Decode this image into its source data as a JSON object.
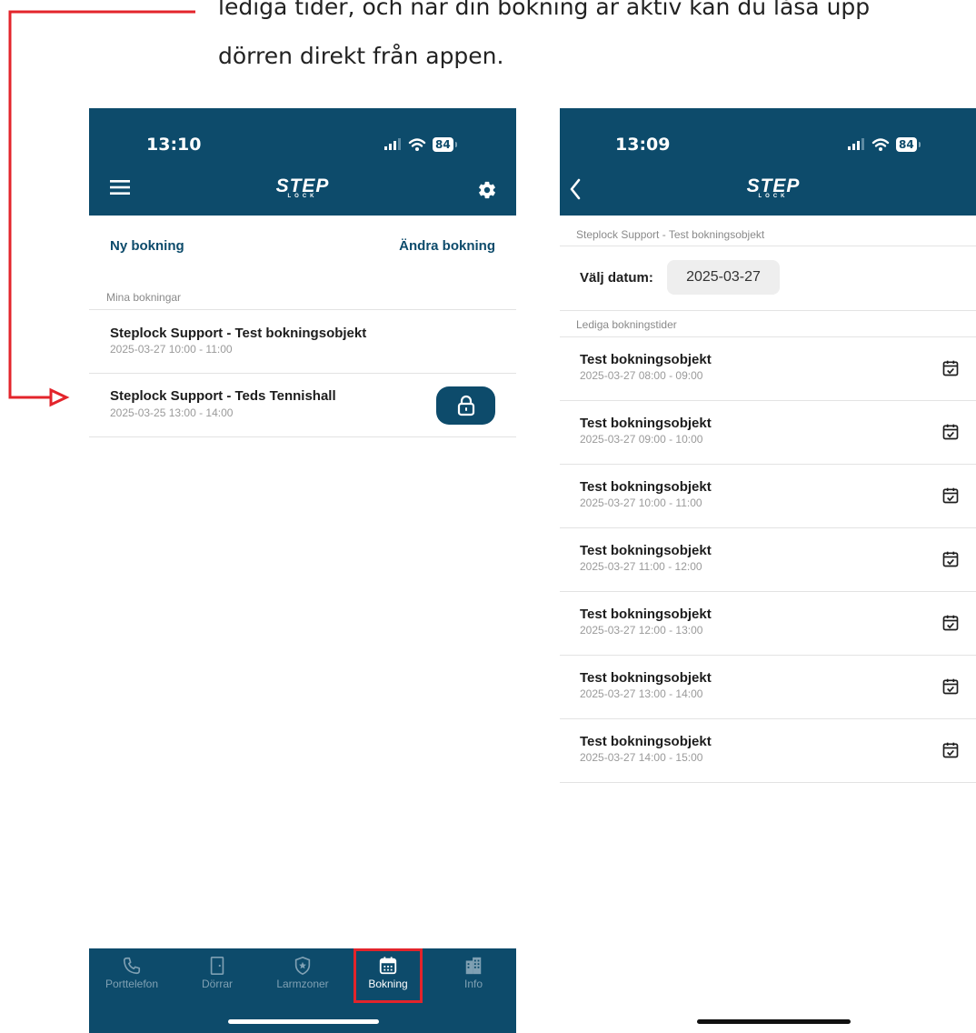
{
  "intro": {
    "line1": "lediga tider, och när din bokning är aktiv kan du låsa upp",
    "line2": "dörren direkt från appen."
  },
  "colors": {
    "brand": "#0d4b6b",
    "callout_red": "#e3242b"
  },
  "left_phone": {
    "status_time": "13:10",
    "battery": "84",
    "logo": "STEP",
    "logo_sub": "LOCK",
    "menu_icon": "hamburger-icon",
    "settings_icon": "gear-icon",
    "new_booking_link": "Ny bokning",
    "edit_booking_link": "Ändra bokning",
    "section_label": "Mina bokningar",
    "bookings": [
      {
        "title": "Steplock Support - Test bokningsobjekt",
        "time": "2025-03-27 10:00 - 11:00"
      },
      {
        "title": "Steplock Support - Teds Tennishall",
        "time": "2025-03-25 13:00 - 14:00"
      }
    ],
    "lock_icon": "unlock-icon",
    "tabs": [
      {
        "label": "Porttelefon",
        "icon": "phone-icon"
      },
      {
        "label": "Dörrar",
        "icon": "door-icon"
      },
      {
        "label": "Larmzoner",
        "icon": "shield-star-icon"
      },
      {
        "label": "Bokning",
        "icon": "calendar-icon",
        "active": true
      },
      {
        "label": "Info",
        "icon": "building-icon"
      }
    ]
  },
  "right_phone": {
    "status_time": "13:09",
    "battery": "84",
    "logo": "STEP",
    "logo_sub": "LOCK",
    "back_icon": "chevron-left-icon",
    "breadcrumb": "Steplock Support - Test bokningsobjekt",
    "date_label": "Välj datum:",
    "date_value": "2025-03-27",
    "section_label": "Lediga bokningstider",
    "slot_icon": "calendar-check-icon",
    "slots": [
      {
        "title": "Test bokningsobjekt",
        "time": "2025-03-27 08:00 - 09:00"
      },
      {
        "title": "Test bokningsobjekt",
        "time": "2025-03-27 09:00 - 10:00"
      },
      {
        "title": "Test bokningsobjekt",
        "time": "2025-03-27 10:00 - 11:00"
      },
      {
        "title": "Test bokningsobjekt",
        "time": "2025-03-27 11:00 - 12:00"
      },
      {
        "title": "Test bokningsobjekt",
        "time": "2025-03-27 12:00 - 13:00"
      },
      {
        "title": "Test bokningsobjekt",
        "time": "2025-03-27 13:00 - 14:00"
      },
      {
        "title": "Test bokningsobjekt",
        "time": "2025-03-27 14:00 - 15:00"
      }
    ]
  }
}
